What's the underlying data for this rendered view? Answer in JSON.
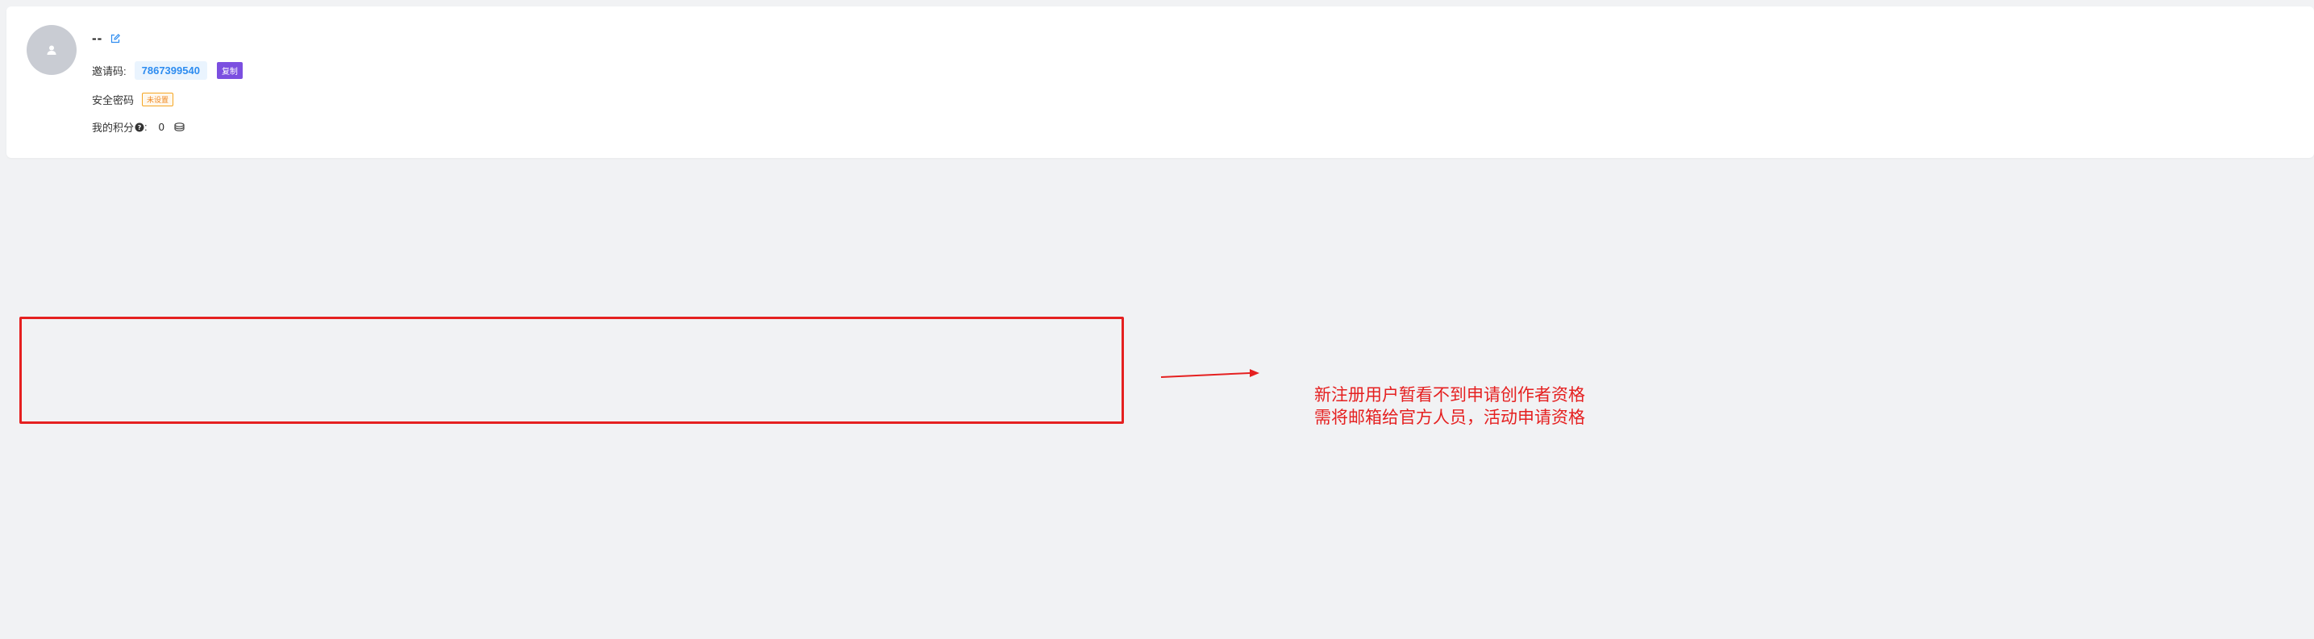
{
  "profile": {
    "username": "--",
    "invite_label": "邀请码:",
    "invite_code": "7867399540",
    "copy_label": "复制",
    "password_label": "安全密码",
    "password_status": "未设置",
    "points_label": "我的积分",
    "points_suffix": ":",
    "points_value": "0"
  },
  "annotation": {
    "line1": "新注册用户暂看不到申请创作者资格",
    "line2": "需将邮箱给官方人员，活动申请资格"
  },
  "colors": {
    "accent_blue": "#2d8cf0",
    "copy_purple": "#7b4fe0",
    "warning_orange": "#f08a24",
    "annotation_red": "#e52020"
  }
}
